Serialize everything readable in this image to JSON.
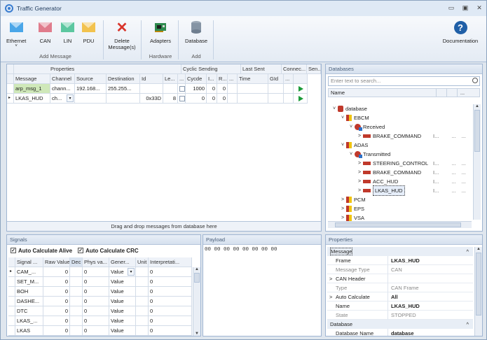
{
  "window": {
    "title": "Traffic Generator",
    "controls": [
      "▭",
      "▣",
      "✕"
    ]
  },
  "ribbon": {
    "add_message": {
      "buttons": [
        {
          "label": "Ethernet",
          "color": "#4aa6e8",
          "dropdown": "˅"
        },
        {
          "label": "CAN",
          "color": "#e07c8c"
        },
        {
          "label": "LIN",
          "color": "#5cc7a0"
        },
        {
          "label": "PDU",
          "color": "#f2c24e"
        }
      ],
      "group_label": "Add Message"
    },
    "delete": {
      "label_line1": "Delete",
      "label_line2": "Message(s)"
    },
    "hardware": {
      "button": "Adapters",
      "group_label": "Hardware"
    },
    "add": {
      "button": "Database",
      "group_label": "Add"
    },
    "documentation": {
      "label": "Documentation"
    }
  },
  "grid": {
    "group_headers": [
      "Properties",
      "Cyclic Sending",
      "Last Sent",
      "Connec...",
      "Sen..."
    ],
    "columns": [
      "Message",
      "Channel",
      "Source",
      "Destination",
      "Id",
      "Le...",
      "...",
      "Cycde",
      "I...",
      "R...",
      "...",
      "Time",
      "GId",
      "..."
    ],
    "rows": [
      {
        "message": "arp_msg_1",
        "channel": "chann...",
        "source": "192.168...",
        "destination": "255.255...",
        "id": "",
        "length": "",
        "cycle": "1000",
        "i": "0",
        "r": "0"
      },
      {
        "message": "LKAS_HUD",
        "channel": "ch...",
        "source": "",
        "destination": "",
        "id": "0x33D",
        "length": "8",
        "cycle": "0",
        "i": "0",
        "r": "0"
      }
    ],
    "row_marker": "▸",
    "dropdown_glyph": "▾",
    "footer": "Drag and drop messages from database here"
  },
  "databases": {
    "title": "Databases",
    "search_placeholder": "Enter text to search...",
    "name_header": "Name",
    "tree": [
      {
        "label": "database",
        "level": 0,
        "kind": "db",
        "chev": "˅"
      },
      {
        "label": "EBCM",
        "level": 1,
        "kind": "ecu",
        "chev": "˅"
      },
      {
        "label": "Received",
        "level": 2,
        "kind": "dir",
        "chev": "˅"
      },
      {
        "label": "BRAKE_COMMAND",
        "level": 3,
        "kind": "msg",
        "chev": ">"
      },
      {
        "label": "ADAS",
        "level": 1,
        "kind": "ecu",
        "chev": "˅"
      },
      {
        "label": "Transmitted",
        "level": 2,
        "kind": "dir",
        "chev": "˅"
      },
      {
        "label": "STEERING_CONTROL",
        "level": 3,
        "kind": "msg",
        "chev": ">"
      },
      {
        "label": "BRAKE_COMMAND",
        "level": 3,
        "kind": "msg",
        "chev": ">"
      },
      {
        "label": "ACC_HUD",
        "level": 3,
        "kind": "msg",
        "chev": ">"
      },
      {
        "label": "LKAS_HUD",
        "level": 3,
        "kind": "msg",
        "chev": ">",
        "selected": true
      },
      {
        "label": "PCM",
        "level": 1,
        "kind": "ecu",
        "chev": ">"
      },
      {
        "label": "EPS",
        "level": 1,
        "kind": "ecu",
        "chev": ">"
      },
      {
        "label": "VSA",
        "level": 1,
        "kind": "ecu",
        "chev": ">"
      }
    ],
    "col_glyph": "I...",
    "ellipsis": "..."
  },
  "signals": {
    "title": "Signals",
    "auto_alive": "Auto Calculate Alive",
    "auto_crc": "Auto Calculate CRC",
    "columns": [
      "Signal ...",
      "Raw Value",
      "Dec",
      "Phys va...",
      "Gener...",
      "Unit",
      "Interpretati..."
    ],
    "rows": [
      {
        "name": "CAM_...",
        "raw": "0",
        "phys": "0",
        "gen": "Value",
        "interp": "0",
        "dropdown": "▾"
      },
      {
        "name": "SET_M...",
        "raw": "0",
        "phys": "0",
        "gen": "Value",
        "interp": "0"
      },
      {
        "name": "BOH",
        "raw": "0",
        "phys": "0",
        "gen": "Value",
        "interp": "0"
      },
      {
        "name": "DASHE...",
        "raw": "0",
        "phys": "0",
        "gen": "Value",
        "interp": "0"
      },
      {
        "name": "DTC",
        "raw": "0",
        "phys": "0",
        "gen": "Value",
        "interp": "0"
      },
      {
        "name": "LKAS_...",
        "raw": "0",
        "phys": "0",
        "gen": "Value",
        "interp": "0"
      },
      {
        "name": "LKAS",
        "raw": "0",
        "phys": "0",
        "gen": "Value",
        "interp": "0"
      }
    ]
  },
  "payload": {
    "title": "Payload",
    "bytes": "00  00  00  00  00  00  00  00"
  },
  "properties": {
    "title": "Properties",
    "rows": [
      {
        "type": "cat",
        "label": "Message",
        "glyph": "^"
      },
      {
        "type": "prop",
        "label": "Frame",
        "value": "LKAS_HUD",
        "bold": true
      },
      {
        "type": "prop",
        "label": "Message Type",
        "value": "CAN",
        "muted": true
      },
      {
        "type": "prop",
        "label": "CAN Header",
        "value": "",
        "chev": ">"
      },
      {
        "type": "prop",
        "label": "Type",
        "value": "CAN Frame",
        "muted": true
      },
      {
        "type": "prop",
        "label": "Auto Calculate",
        "value": "All",
        "bold": true,
        "chev": ">"
      },
      {
        "type": "prop",
        "label": "Name",
        "value": "LKAS_HUD",
        "bold": true
      },
      {
        "type": "prop",
        "label": "State",
        "value": "STOPPED",
        "muted": true
      },
      {
        "type": "cat",
        "label": "Database",
        "glyph": "^"
      },
      {
        "type": "prop",
        "label": "Database Name",
        "value": "database",
        "bold": true
      }
    ]
  },
  "colors": {
    "accent": "#1e395b",
    "play": "#1c9b3a",
    "selected_row": "#cfe8b9",
    "delete": "#d9352b",
    "help": "#1f5fa7"
  }
}
